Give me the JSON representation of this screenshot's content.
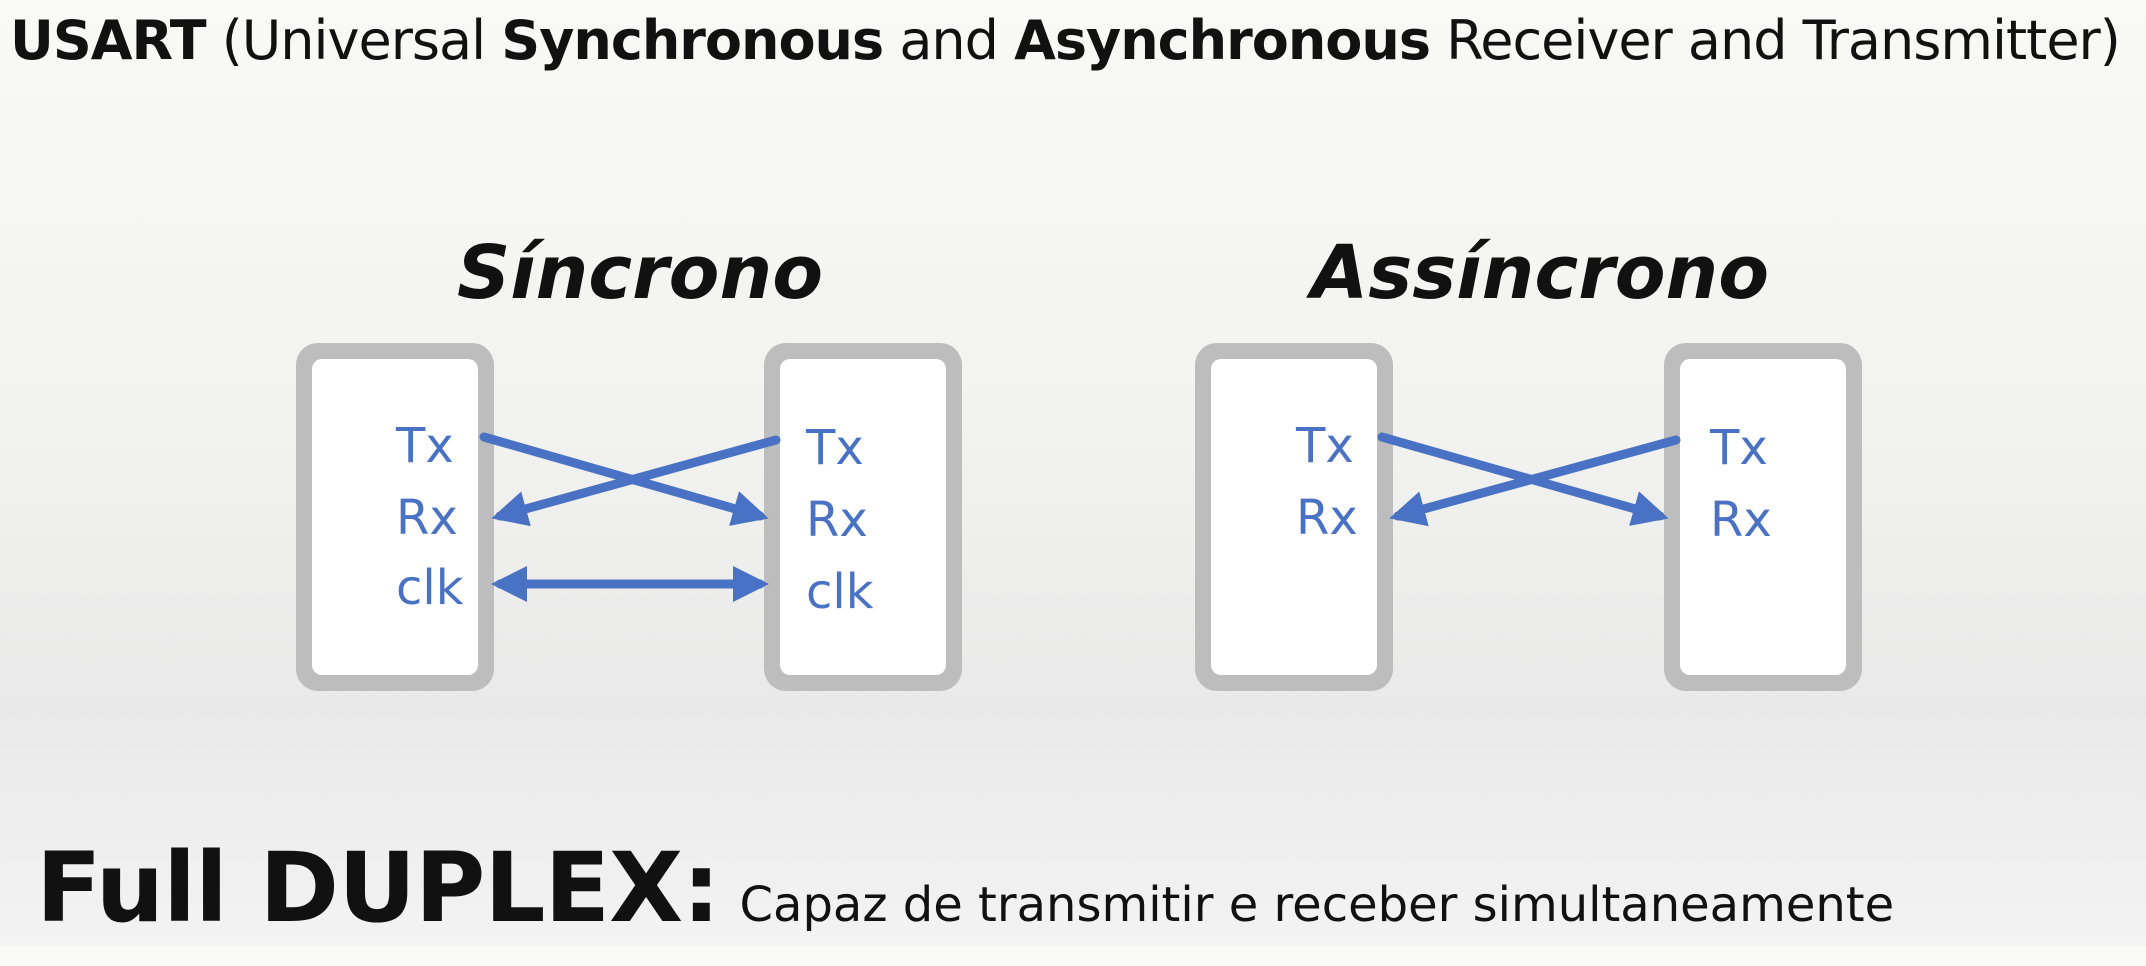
{
  "header": {
    "usart": "USART",
    "open_paren": "(Universal ",
    "synchronous": "Synchronous",
    "and1": " and ",
    "asynchronous": "Asynchronous",
    "rest": " Receiver and Transmitter)"
  },
  "synchronous": {
    "title": "Síncrono",
    "left_pins": [
      "Tx",
      "Rx",
      "clk"
    ],
    "right_pins": [
      "Tx",
      "Rx",
      "clk"
    ]
  },
  "asynchronous": {
    "title": "Assíncrono",
    "left_pins": [
      "Tx",
      "Rx"
    ],
    "right_pins": [
      "Tx",
      "Rx"
    ]
  },
  "footer": {
    "term": "Full DUPLEX:",
    "description": "Capaz de transmitir e receber simultaneamente"
  },
  "colors": {
    "arrow": "#4a72c4",
    "box_border": "#bdbdbd",
    "text": "#111111"
  }
}
